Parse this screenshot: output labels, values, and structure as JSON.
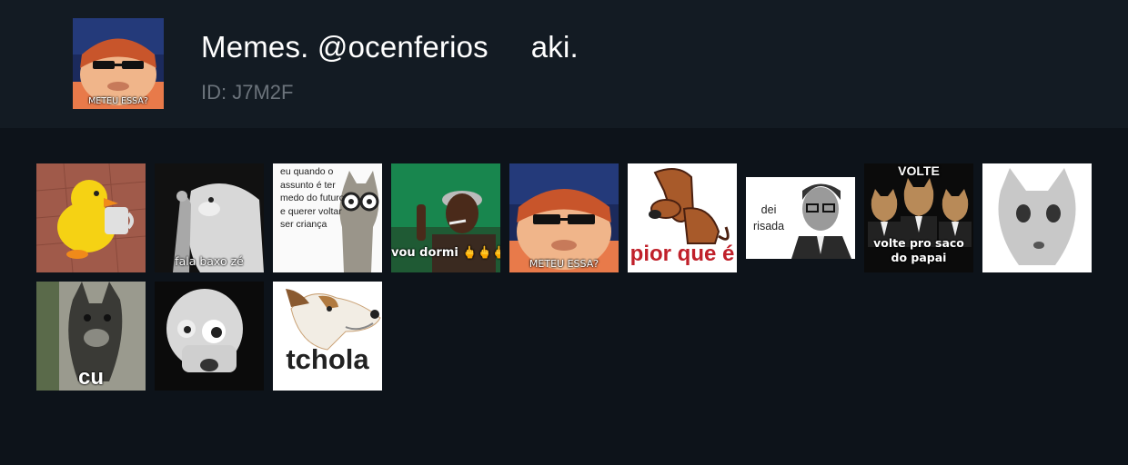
{
  "pack": {
    "title": "Memes. @ocenferios     aki.",
    "id_label": "ID: J7M2F",
    "cover_caption": "METEU ESSA?"
  },
  "stickers": [
    {
      "name": "duck-with-mug",
      "caption": ""
    },
    {
      "name": "dog-shush",
      "caption": "fala baxo zé"
    },
    {
      "name": "cat-glasses",
      "caption": "eu quando o\nassunto é ter\nmedo do futuro\ne querer voltar\nser criança"
    },
    {
      "name": "man-smoking",
      "caption": "vou dormi 🖕🖕🖕"
    },
    {
      "name": "boy-sunglasses",
      "caption": "METEU ESSA?"
    },
    {
      "name": "sad-dog-cartoon",
      "caption": "pior que é"
    },
    {
      "name": "man-glasses",
      "caption": "dei\nrisada"
    },
    {
      "name": "cats-suits",
      "caption_top": "VOLTE",
      "caption": "volte pro saco\ndo papai"
    },
    {
      "name": "cat-face",
      "caption": ""
    },
    {
      "name": "schnauzer",
      "caption": "cu"
    },
    {
      "name": "skull",
      "caption": ""
    },
    {
      "name": "smirking-dog",
      "caption": "tchola"
    }
  ],
  "colors": {
    "background": "#0d131a",
    "header": "#131b23",
    "title": "#ffffff",
    "id": "#6b737b"
  }
}
